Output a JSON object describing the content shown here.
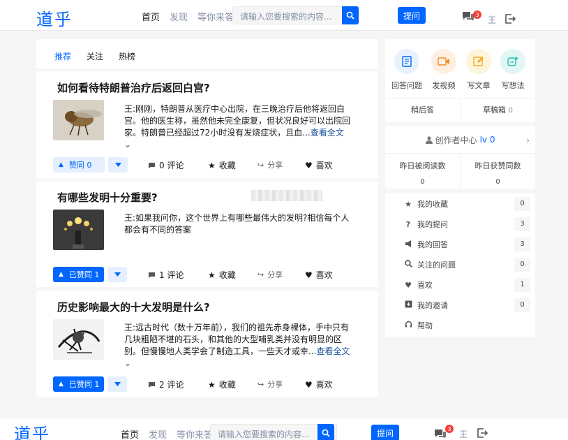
{
  "header": {
    "logo": "道乎",
    "nav": [
      "首页",
      "发现",
      "等你来答"
    ],
    "search_placeholder": "请输入您要搜索的内容...",
    "ask_button": "提问",
    "message_count": "3",
    "user_initial": "王"
  },
  "feed_tabs": [
    "推荐",
    "关注",
    "热榜"
  ],
  "questions": [
    {
      "title": "如何看待特朗普治疗后返回白宫?",
      "excerpt": "王:刚刚，特朗普从医疗中心出院，在三晚治疗后他将返回白宫。他的医生称，虽然他未完全康复，但状况良好可以出院回家。特朗普已经超过72小时没有发烧症状，且血...",
      "read_more": "查看全文",
      "vote_label": "赞同 0",
      "voted": false,
      "comments": "0 评论",
      "favorite": "收藏",
      "share": "分享",
      "like": "喜欢"
    },
    {
      "title": "有哪些发明十分重要?",
      "excerpt": "王:如果我问你，这个世界上有哪些最伟大的发明?相信每个人都会有不同的答案",
      "read_more": "",
      "vote_label": "已赞同 1",
      "voted": true,
      "comments": "1 评论",
      "favorite": "收藏",
      "share": "分享",
      "like": "喜欢"
    },
    {
      "title": "历史影响最大的十大发明是什么?",
      "excerpt": "王:远古时代（数十万年前），我们的祖先赤身裸体，手中只有几块粗陋不堪的石头，和其他的大型哺乳类并没有明显的区别。但慢慢地人类学会了制造工具，一些天才或幸...",
      "read_more": "查看全文",
      "vote_label": "已赞同 1",
      "voted": true,
      "comments": "2 评论",
      "favorite": "收藏",
      "share": "分享",
      "like": "喜欢"
    }
  ],
  "create": {
    "items": [
      {
        "label": "回答问题",
        "icon": "answer-icon",
        "bg": "#e8f1fe",
        "color": "#0066ff"
      },
      {
        "label": "发视频",
        "icon": "video-icon",
        "bg": "#fdf0e2",
        "color": "#f28c28"
      },
      {
        "label": "写文章",
        "icon": "article-icon",
        "bg": "#fdf5d9",
        "color": "#f5a623"
      },
      {
        "label": "写想法",
        "icon": "idea-icon",
        "bg": "#e2f6f3",
        "color": "#1dbfaf"
      }
    ],
    "drafts_later": "稍后答",
    "drafts_box": "草稿箱",
    "drafts_count": "0"
  },
  "creator_center": {
    "label": "创作者中心",
    "level": "lv 0",
    "read_label": "昨日被阅读数",
    "read_value": "0",
    "agree_label": "昨日获赞同数",
    "agree_value": "0"
  },
  "menu": [
    {
      "label": "我的收藏",
      "count": "0",
      "icon": "star-icon"
    },
    {
      "label": "我的提问",
      "count": "3",
      "icon": "question-icon"
    },
    {
      "label": "我的回答",
      "count": "3",
      "icon": "megaphone-icon"
    },
    {
      "label": "关注的问题",
      "count": "0",
      "icon": "search-icon"
    },
    {
      "label": "喜欢",
      "count": "1",
      "icon": "heart-icon"
    },
    {
      "label": "我的邀请",
      "count": "0",
      "icon": "invite-icon"
    },
    {
      "label": "帮助",
      "count": "",
      "icon": "headset-icon"
    }
  ],
  "colors": {
    "brand": "#0066ff",
    "background": "#f6f6f6",
    "badge": "#f1403c"
  }
}
